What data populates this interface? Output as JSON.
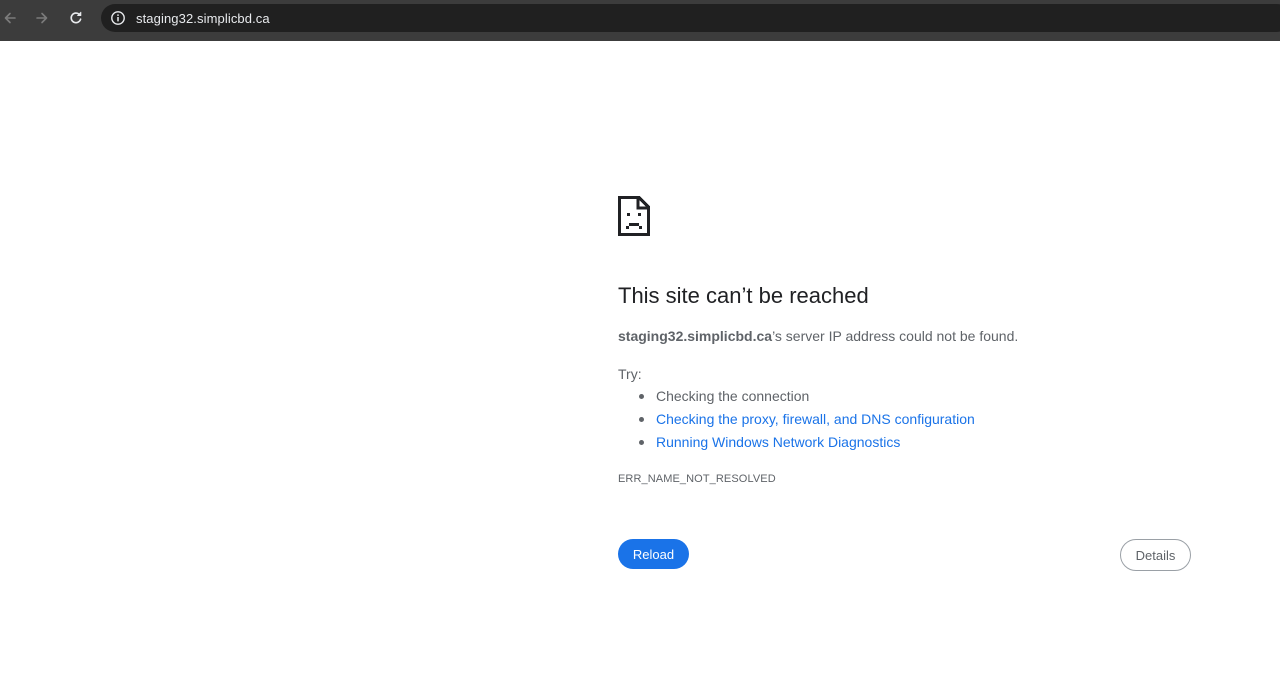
{
  "browser": {
    "back_icon": "arrow-left-icon",
    "forward_icon": "arrow-right-icon",
    "reload_icon": "reload-icon",
    "site_info_icon": "info-circle-icon",
    "url": "staging32.simplicbd.ca"
  },
  "error_page": {
    "icon": "sad-document-icon",
    "headline": "This site can’t be reached",
    "message_host": "staging32.simplicbd.ca",
    "message_rest": "’s server IP address could not be found.",
    "try_label": "Try:",
    "suggestions": [
      {
        "label": "Checking the connection",
        "is_link": false
      },
      {
        "label": "Checking the proxy, firewall, and DNS configuration",
        "is_link": true
      },
      {
        "label": "Running Windows Network Diagnostics",
        "is_link": true
      }
    ],
    "error_code": "ERR_NAME_NOT_RESOLVED",
    "reload_label": "Reload",
    "details_label": "Details"
  },
  "colors": {
    "toolbar_bg": "#3c3c3c",
    "omnibox_bg": "#202020",
    "link": "#1a73e8",
    "primary_button": "#1a73e8",
    "text_secondary": "#5f6368",
    "headline": "#202124"
  }
}
